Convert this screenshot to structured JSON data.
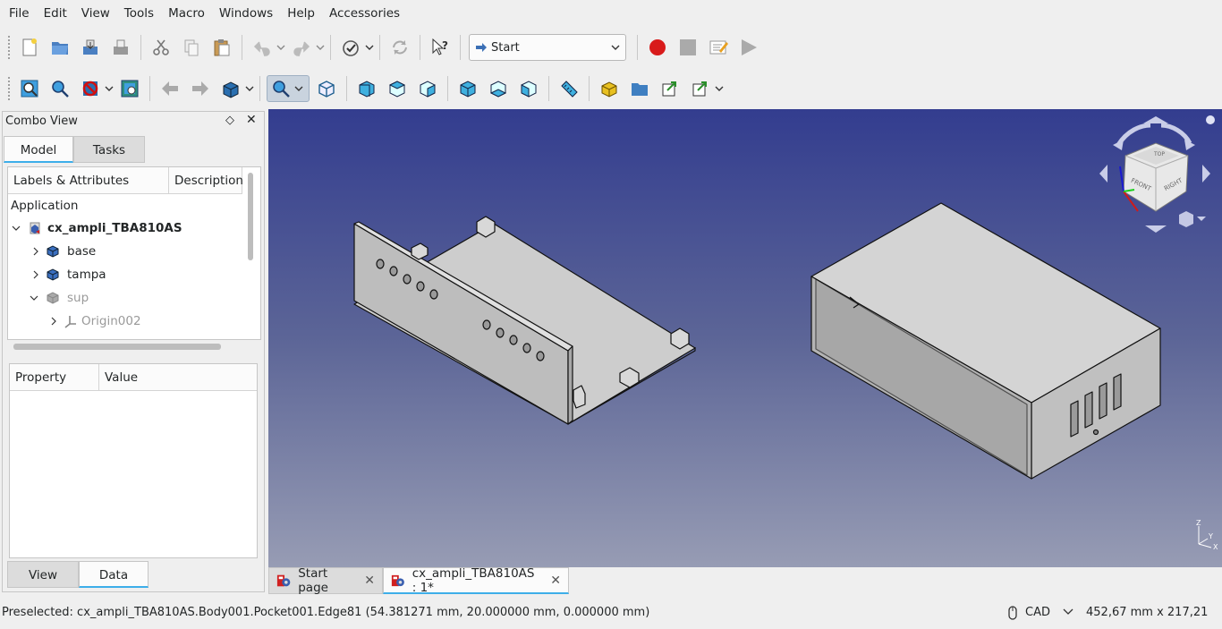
{
  "menu": [
    "File",
    "Edit",
    "View",
    "Tools",
    "Macro",
    "Windows",
    "Help",
    "Accessories"
  ],
  "toolbar": {
    "workbench": "Start",
    "icons_row1": [
      "new-file-icon",
      "open-file-icon",
      "save-icon",
      "save-as-icon",
      "cut-icon",
      "copy-icon",
      "paste-icon",
      "undo-icon",
      "redo-icon",
      "check-icon",
      "refresh-icon",
      "whats-this-icon",
      "record-macro-icon",
      "stop-macro-icon",
      "edit-macro-icon",
      "run-macro-icon"
    ],
    "icons_row2": [
      "fit-all-icon",
      "fit-selection-icon",
      "draw-style-icon",
      "bounding-box-icon",
      "back-icon",
      "forward-icon",
      "sync-view-icon",
      "zoom-icon",
      "isometric-icon",
      "front-view-icon",
      "top-view-icon",
      "right-view-icon",
      "rear-view-icon",
      "bottom-view-icon",
      "left-view-icon",
      "measure-icon",
      "part-icon",
      "group-icon",
      "link-icon",
      "link-actions-icon"
    ]
  },
  "combo": {
    "title": "Combo View",
    "tabs": [
      "Model",
      "Tasks"
    ],
    "active_tab": "Model",
    "tree_header": [
      "Labels & Attributes",
      "Description"
    ],
    "tree": {
      "section": "Application",
      "document": "cx_ampli_TBA810AS",
      "items": [
        {
          "label": "base",
          "hidden": false
        },
        {
          "label": "tampa",
          "hidden": false
        },
        {
          "label": "sup",
          "hidden": true
        },
        {
          "label": "Origin002",
          "hidden": true
        }
      ]
    },
    "prop_header": [
      "Property",
      "Value"
    ],
    "bottom_tabs": [
      "View",
      "Data"
    ],
    "bottom_active": "Data"
  },
  "navcube": {
    "face_front": "FRONT",
    "face_right": "RIGHT",
    "face_top": "TOP"
  },
  "axis": {
    "x": "X",
    "y": "Y",
    "z": "Z"
  },
  "doc_tabs": [
    {
      "label": "Start page",
      "active": false
    },
    {
      "label": "cx_ampli_TBA810AS : 1*",
      "active": true
    }
  ],
  "status": {
    "message": "Preselected: cx_ampli_TBA810AS.Body001.Pocket001.Edge81 (54.381271 mm, 20.000000 mm, 0.000000 mm)",
    "nav_style": "CAD",
    "dimensions": "452,67 mm x 217,21 mm"
  },
  "colors": {
    "accent": "#3daee9",
    "viewport_top": "#333d8f",
    "viewport_bottom": "#979cb4",
    "model_gray": "#cfcfcf"
  }
}
